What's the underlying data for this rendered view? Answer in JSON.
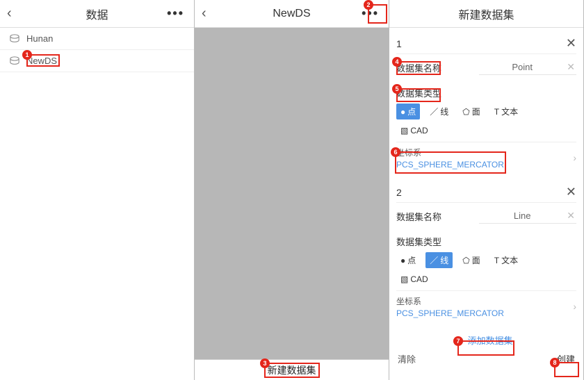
{
  "panel1": {
    "title": "数据",
    "items": [
      {
        "label": "Hunan"
      },
      {
        "label": "NewDS"
      }
    ]
  },
  "panel2": {
    "title": "NewDS",
    "bottom_button": "新建数据集"
  },
  "panel3": {
    "title": "新建数据集",
    "cards": [
      {
        "index": "1",
        "name_label": "数据集名称",
        "name_value": "Point",
        "type_label": "数据集类型",
        "types": {
          "point": "点",
          "line": "线",
          "region": "面",
          "text": "文本",
          "cad": "CAD"
        },
        "selected_type": "point",
        "coord_label": "坐标系",
        "coord_value": "PCS_SPHERE_MERCATOR"
      },
      {
        "index": "2",
        "name_label": "数据集名称",
        "name_value": "Line",
        "type_label": "数据集类型",
        "types": {
          "point": "点",
          "line": "线",
          "region": "面",
          "text": "文本",
          "cad": "CAD"
        },
        "selected_type": "line",
        "coord_label": "坐标系",
        "coord_value": "PCS_SPHERE_MERCATOR"
      }
    ],
    "add_label": "+ 添加数据集",
    "clear_label": "清除",
    "create_label": "创建"
  },
  "annotations": {
    "a1": "1",
    "a2": "2",
    "a3": "3",
    "a4": "4",
    "a5": "5",
    "a6": "6",
    "a7": "7",
    "a8": "8"
  }
}
